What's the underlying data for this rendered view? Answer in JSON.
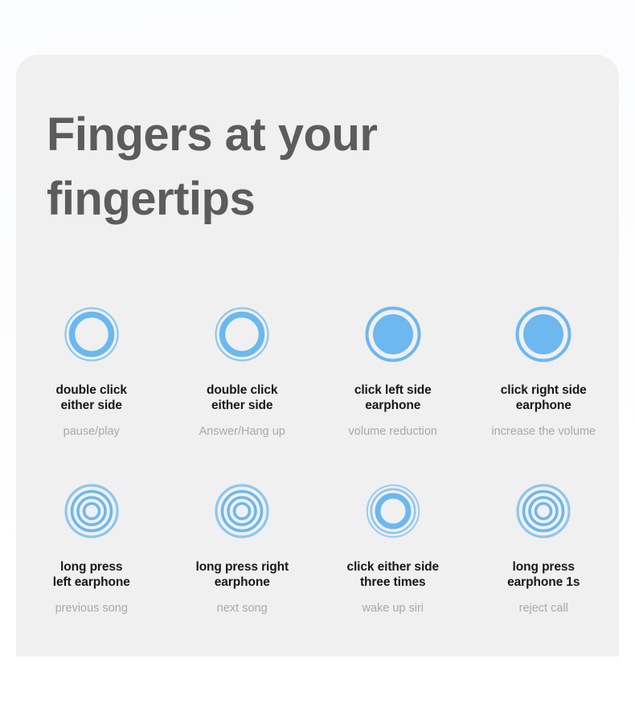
{
  "card": {
    "title": "Fingers at your\nfingertips",
    "background_color": "#f0f0f0",
    "title_color": "#5c5c5c",
    "accent_color": "#6cb8ef"
  },
  "gestures": [
    {
      "icon": "ring-single-thick-icon",
      "label": "double click\neither side",
      "caption": "pause/play"
    },
    {
      "icon": "ring-single-thick-icon",
      "label": "double click\neither side",
      "caption": "Answer/Hang up"
    },
    {
      "icon": "filled-circle-icon",
      "label": "click left side\nearphone",
      "caption": "volume reduction"
    },
    {
      "icon": "filled-circle-icon",
      "label": "click right side\nearphone",
      "caption": "increase the volume"
    },
    {
      "icon": "ripple-four-rings-icon",
      "label": "long press\nleft earphone",
      "caption": "previous song"
    },
    {
      "icon": "ripple-four-rings-icon",
      "label": "long press right\nearphone",
      "caption": "next song"
    },
    {
      "icon": "ripple-thick-inner-icon",
      "label": "click either side\nthree times",
      "caption": "wake up siri"
    },
    {
      "icon": "ripple-four-rings-icon",
      "label": "long press\nearphone 1s",
      "caption": "reject call"
    }
  ]
}
